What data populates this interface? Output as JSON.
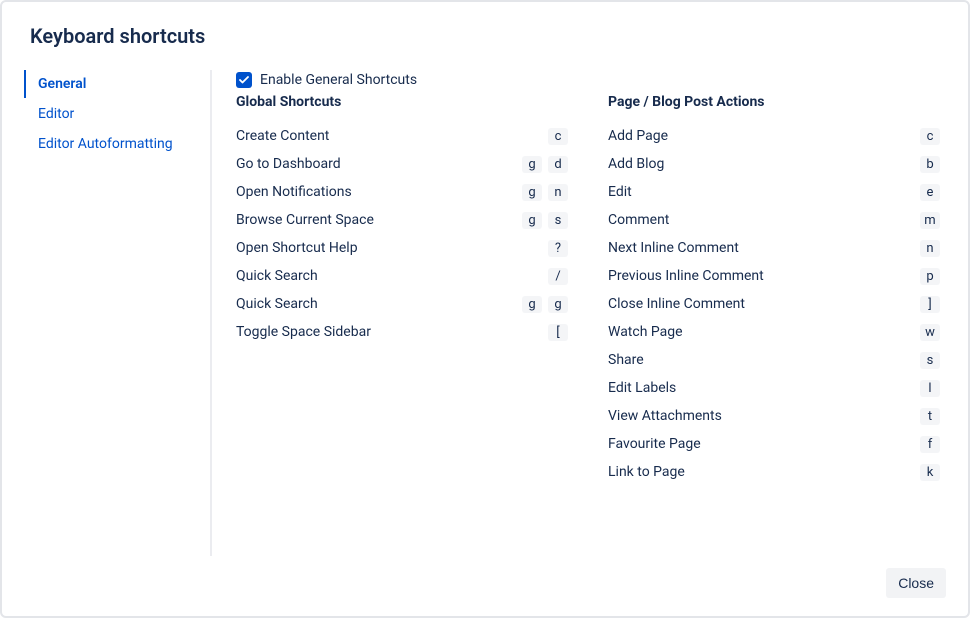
{
  "title": "Keyboard shortcuts",
  "tabs": [
    {
      "label": "General",
      "active": true
    },
    {
      "label": "Editor",
      "active": false
    },
    {
      "label": "Editor Autoformatting",
      "active": false
    }
  ],
  "enable": {
    "checked": true,
    "label": "Enable General Shortcuts"
  },
  "columns": [
    {
      "header": "Global Shortcuts",
      "rows": [
        {
          "label": "Create Content",
          "keys": [
            "c"
          ]
        },
        {
          "label": "Go to Dashboard",
          "keys": [
            "g",
            "d"
          ]
        },
        {
          "label": "Open Notifications",
          "keys": [
            "g",
            "n"
          ]
        },
        {
          "label": "Browse Current Space",
          "keys": [
            "g",
            "s"
          ]
        },
        {
          "label": "Open Shortcut Help",
          "keys": [
            "?"
          ]
        },
        {
          "label": "Quick Search",
          "keys": [
            "/"
          ]
        },
        {
          "label": "Quick Search",
          "keys": [
            "g",
            "g"
          ]
        },
        {
          "label": "Toggle Space Sidebar",
          "keys": [
            "["
          ]
        }
      ]
    },
    {
      "header": "Page / Blog Post Actions",
      "rows": [
        {
          "label": "Add Page",
          "keys": [
            "c"
          ]
        },
        {
          "label": "Add Blog",
          "keys": [
            "b"
          ]
        },
        {
          "label": "Edit",
          "keys": [
            "e"
          ]
        },
        {
          "label": "Comment",
          "keys": [
            "m"
          ]
        },
        {
          "label": "Next Inline Comment",
          "keys": [
            "n"
          ]
        },
        {
          "label": "Previous Inline Comment",
          "keys": [
            "p"
          ]
        },
        {
          "label": "Close Inline Comment",
          "keys": [
            "]"
          ]
        },
        {
          "label": "Watch Page",
          "keys": [
            "w"
          ]
        },
        {
          "label": "Share",
          "keys": [
            "s"
          ]
        },
        {
          "label": "Edit Labels",
          "keys": [
            "l"
          ]
        },
        {
          "label": "View Attachments",
          "keys": [
            "t"
          ]
        },
        {
          "label": "Favourite Page",
          "keys": [
            "f"
          ]
        },
        {
          "label": "Link to Page",
          "keys": [
            "k"
          ]
        }
      ]
    }
  ],
  "footer": {
    "close_label": "Close"
  }
}
